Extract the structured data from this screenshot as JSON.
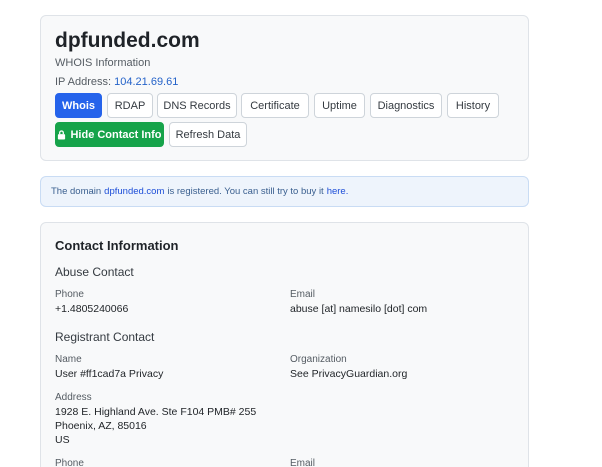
{
  "header": {
    "domain": "dpfunded.com",
    "subtitle": "WHOIS Information",
    "ip_label": "IP Address:",
    "ip_value": "104.21.69.61"
  },
  "tabs": [
    {
      "label": "Whois",
      "active": true
    },
    {
      "label": "RDAP"
    },
    {
      "label": "DNS Records"
    },
    {
      "label": "Certificate"
    },
    {
      "label": "Uptime"
    },
    {
      "label": "Diagnostics"
    },
    {
      "label": "History"
    }
  ],
  "actions": {
    "hide_contact": "Hide Contact Info",
    "refresh": "Refresh Data"
  },
  "alert": {
    "prefix": "The domain",
    "domain": "dpfunded.com",
    "middle": "is registered. You can still try to buy it",
    "link": "here."
  },
  "contact": {
    "title": "Contact Information",
    "abuse": {
      "title": "Abuse Contact",
      "phone_label": "Phone",
      "phone": "+1.4805240066",
      "email_label": "Email",
      "email": "abuse [at] namesilo [dot] com"
    },
    "registrant": {
      "title": "Registrant Contact",
      "name_label": "Name",
      "name": "User #ff1cad7a Privacy",
      "org_label": "Organization",
      "org": "See PrivacyGuardian.org",
      "address_label": "Address",
      "address_line1": "1928 E. Highland Ave. Ste F104 PMB# 255",
      "address_line2": "Phoenix, AZ, 85016",
      "address_line3": "US",
      "phone_label": "Phone",
      "email_label": "Email"
    }
  },
  "colors": {
    "primary": "#2563eb",
    "success": "#16a34a",
    "link": "#2563c9"
  }
}
